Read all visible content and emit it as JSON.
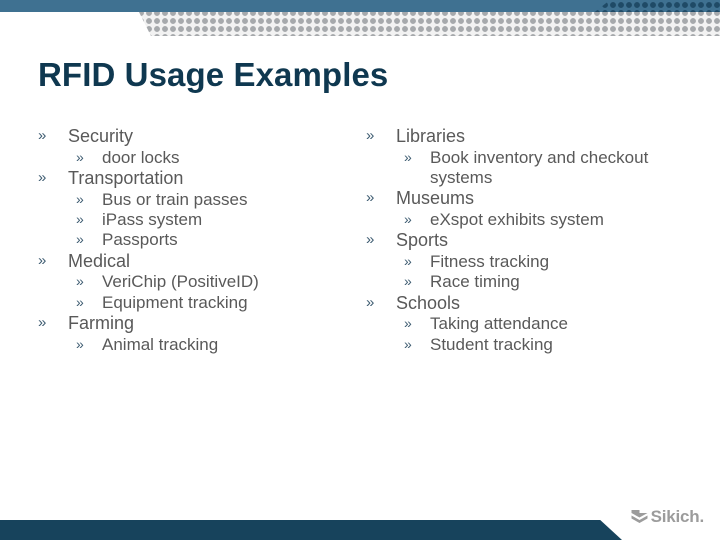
{
  "slide": {
    "title": "RFID Usage Examples",
    "bullet_glyph": "»",
    "colors": {
      "title": "#0f3850",
      "body_text": "#595959",
      "bullet": "#3f5d72",
      "header_bar": "#3f7191",
      "header_dots_blue": "#1f4a66",
      "header_dots_gray": "#a6a9ac",
      "header_dots_bg": "#f2f2f2",
      "footer_bar": "#17435c",
      "logo": "#9c9c9c"
    }
  },
  "columns": {
    "left": [
      {
        "label": "Security",
        "children": [
          {
            "label": "door locks"
          }
        ]
      },
      {
        "label": "Transportation",
        "children": [
          {
            "label": "Bus or train passes"
          },
          {
            "label": "iPass system"
          },
          {
            "label": "Passports"
          }
        ]
      },
      {
        "label": "Medical",
        "children": [
          {
            "label": "VeriChip (PositiveID)"
          },
          {
            "label": "Equipment tracking"
          }
        ]
      },
      {
        "label": "Farming",
        "children": [
          {
            "label": "Animal tracking"
          }
        ]
      }
    ],
    "right": [
      {
        "label": "Libraries",
        "children": [
          {
            "label": "Book inventory and checkout systems"
          }
        ]
      },
      {
        "label": "Museums",
        "children": [
          {
            "label": "eXspot exhibits system"
          }
        ]
      },
      {
        "label": "Sports",
        "children": [
          {
            "label": "Fitness tracking"
          },
          {
            "label": "Race timing"
          }
        ]
      },
      {
        "label": "Schools",
        "children": [
          {
            "label": "Taking attendance"
          },
          {
            "label": "Student tracking"
          }
        ]
      }
    ]
  },
  "footer": {
    "logo_text": "Sikich.",
    "logo_mark_name": "sikich-chevron-mark"
  }
}
